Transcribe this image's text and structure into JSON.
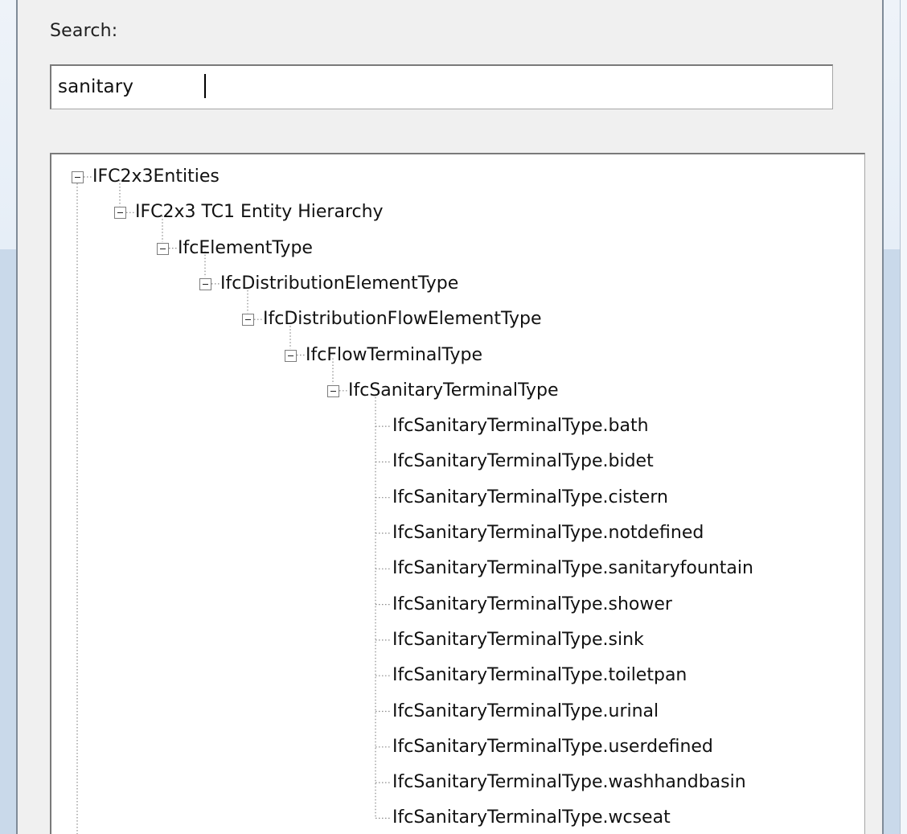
{
  "search": {
    "label": "Search:",
    "value": "sanitary"
  },
  "tree": {
    "nodes": [
      {
        "label": "IFC2x3Entities",
        "level": 0,
        "expanded": true
      },
      {
        "label": "IFC2x3 TC1 Entity Hierarchy",
        "level": 1,
        "expanded": true
      },
      {
        "label": "IfcElementType",
        "level": 2,
        "expanded": true
      },
      {
        "label": "IfcDistributionElementType",
        "level": 3,
        "expanded": true
      },
      {
        "label": "IfcDistributionFlowElementType",
        "level": 4,
        "expanded": true
      },
      {
        "label": "IfcFlowTerminalType",
        "level": 5,
        "expanded": true
      },
      {
        "label": "IfcSanitaryTerminalType",
        "level": 6,
        "expanded": true
      },
      {
        "label": "IfcSanitaryTerminalType.bath",
        "level": 7,
        "leaf": true
      },
      {
        "label": "IfcSanitaryTerminalType.bidet",
        "level": 7,
        "leaf": true
      },
      {
        "label": "IfcSanitaryTerminalType.cistern",
        "level": 7,
        "leaf": true
      },
      {
        "label": "IfcSanitaryTerminalType.notdefined",
        "level": 7,
        "leaf": true
      },
      {
        "label": "IfcSanitaryTerminalType.sanitaryfountain",
        "level": 7,
        "leaf": true
      },
      {
        "label": "IfcSanitaryTerminalType.shower",
        "level": 7,
        "leaf": true
      },
      {
        "label": "IfcSanitaryTerminalType.sink",
        "level": 7,
        "leaf": true
      },
      {
        "label": "IfcSanitaryTerminalType.toiletpan",
        "level": 7,
        "leaf": true
      },
      {
        "label": "IfcSanitaryTerminalType.urinal",
        "level": 7,
        "leaf": true
      },
      {
        "label": "IfcSanitaryTerminalType.userdefined",
        "level": 7,
        "leaf": true
      },
      {
        "label": "IfcSanitaryTerminalType.washhandbasin",
        "level": 7,
        "leaf": true
      },
      {
        "label": "IfcSanitaryTerminalType.wcseat",
        "level": 7,
        "leaf": true
      }
    ]
  }
}
